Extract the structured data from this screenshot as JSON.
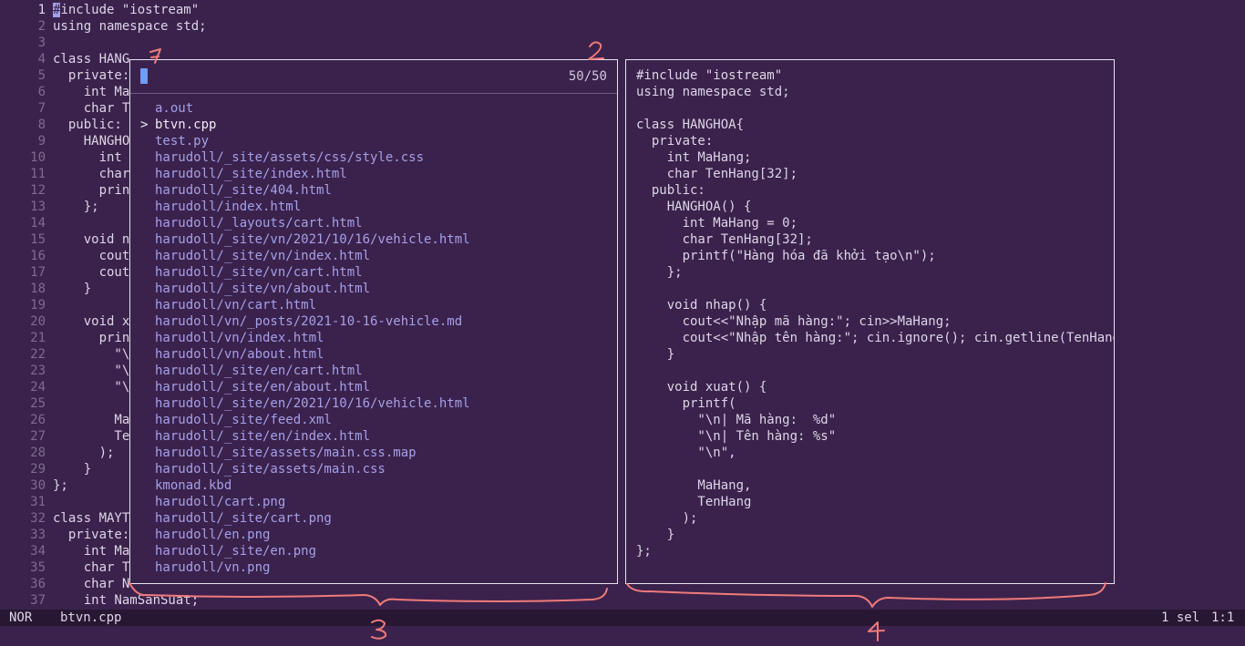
{
  "editor": {
    "lines": [
      {
        "n": "1",
        "text": "#include \"iostream\""
      },
      {
        "n": "2",
        "text": "using namespace std;"
      },
      {
        "n": "3",
        "text": ""
      },
      {
        "n": "4",
        "text": "class HANG"
      },
      {
        "n": "5",
        "text": "  private:"
      },
      {
        "n": "6",
        "text": "    int Ma"
      },
      {
        "n": "7",
        "text": "    char T"
      },
      {
        "n": "8",
        "text": "  public:"
      },
      {
        "n": "9",
        "text": "    HANGHO"
      },
      {
        "n": "10",
        "text": "      int"
      },
      {
        "n": "11",
        "text": "      char"
      },
      {
        "n": "12",
        "text": "      prin"
      },
      {
        "n": "13",
        "text": "    };"
      },
      {
        "n": "14",
        "text": ""
      },
      {
        "n": "15",
        "text": "    void n"
      },
      {
        "n": "16",
        "text": "      cout"
      },
      {
        "n": "17",
        "text": "      cout"
      },
      {
        "n": "18",
        "text": "    }"
      },
      {
        "n": "19",
        "text": ""
      },
      {
        "n": "20",
        "text": "    void x"
      },
      {
        "n": "21",
        "text": "      prin"
      },
      {
        "n": "22",
        "text": "        \"\\"
      },
      {
        "n": "23",
        "text": "        \"\\"
      },
      {
        "n": "24",
        "text": "        \"\\"
      },
      {
        "n": "25",
        "text": ""
      },
      {
        "n": "26",
        "text": "        Ma"
      },
      {
        "n": "27",
        "text": "        Te"
      },
      {
        "n": "28",
        "text": "      );"
      },
      {
        "n": "29",
        "text": "    }"
      },
      {
        "n": "30",
        "text": "};"
      },
      {
        "n": "31",
        "text": ""
      },
      {
        "n": "32",
        "text": "class MAYT"
      },
      {
        "n": "33",
        "text": "  private:"
      },
      {
        "n": "34",
        "text": "    int Ma"
      },
      {
        "n": "35",
        "text": "    char T"
      },
      {
        "n": "36",
        "text": "    char N"
      },
      {
        "n": "37",
        "text": "    int NamSanSuat;"
      }
    ]
  },
  "picker": {
    "count": "50/50",
    "items": [
      "a.out",
      "btvn.cpp",
      "test.py",
      "harudoll/_site/assets/css/style.css",
      "harudoll/_site/index.html",
      "harudoll/_site/404.html",
      "harudoll/index.html",
      "harudoll/_layouts/cart.html",
      "harudoll/_site/vn/2021/10/16/vehicle.html",
      "harudoll/_site/vn/index.html",
      "harudoll/_site/vn/cart.html",
      "harudoll/_site/vn/about.html",
      "harudoll/vn/cart.html",
      "harudoll/vn/_posts/2021-10-16-vehicle.md",
      "harudoll/vn/index.html",
      "harudoll/vn/about.html",
      "harudoll/_site/en/cart.html",
      "harudoll/_site/en/about.html",
      "harudoll/_site/en/2021/10/16/vehicle.html",
      "harudoll/_site/feed.xml",
      "harudoll/_site/en/index.html",
      "harudoll/_site/assets/main.css.map",
      "harudoll/_site/assets/main.css",
      "kmonad.kbd",
      "harudoll/cart.png",
      "harudoll/_site/cart.png",
      "harudoll/en.png",
      "harudoll/_site/en.png",
      "harudoll/vn.png"
    ],
    "selected_index": 1,
    "selected_marker": ">"
  },
  "preview": {
    "lines": [
      "#include \"iostream\"",
      "using namespace std;",
      "",
      "class HANGHOA{",
      "  private:",
      "    int MaHang;",
      "    char TenHang[32];",
      "  public:",
      "    HANGHOA() {",
      "      int MaHang = 0;",
      "      char TenHang[32];",
      "      printf(\"Hàng hóa đã khởi tạo\\n\");",
      "    };",
      "",
      "    void nhap() {",
      "      cout<<\"Nhập mã hàng:\"; cin>>MaHang;",
      "      cout<<\"Nhập tên hàng:\"; cin.ignore(); cin.getline(TenHang,",
      "    }",
      "",
      "    void xuat() {",
      "      printf(",
      "        \"\\n| Mã hàng:  %d\"",
      "        \"\\n| Tên hàng: %s\"",
      "        \"\\n\",",
      "",
      "        MaHang,",
      "        TenHang",
      "      );",
      "    }",
      "};"
    ]
  },
  "statusbar": {
    "mode": "NOR",
    "file": "btvn.cpp",
    "selections": "1 sel",
    "position": "1:1"
  },
  "annotations": {
    "labels": [
      "1",
      "2",
      "3",
      "4"
    ],
    "color": "#f07a7a"
  }
}
